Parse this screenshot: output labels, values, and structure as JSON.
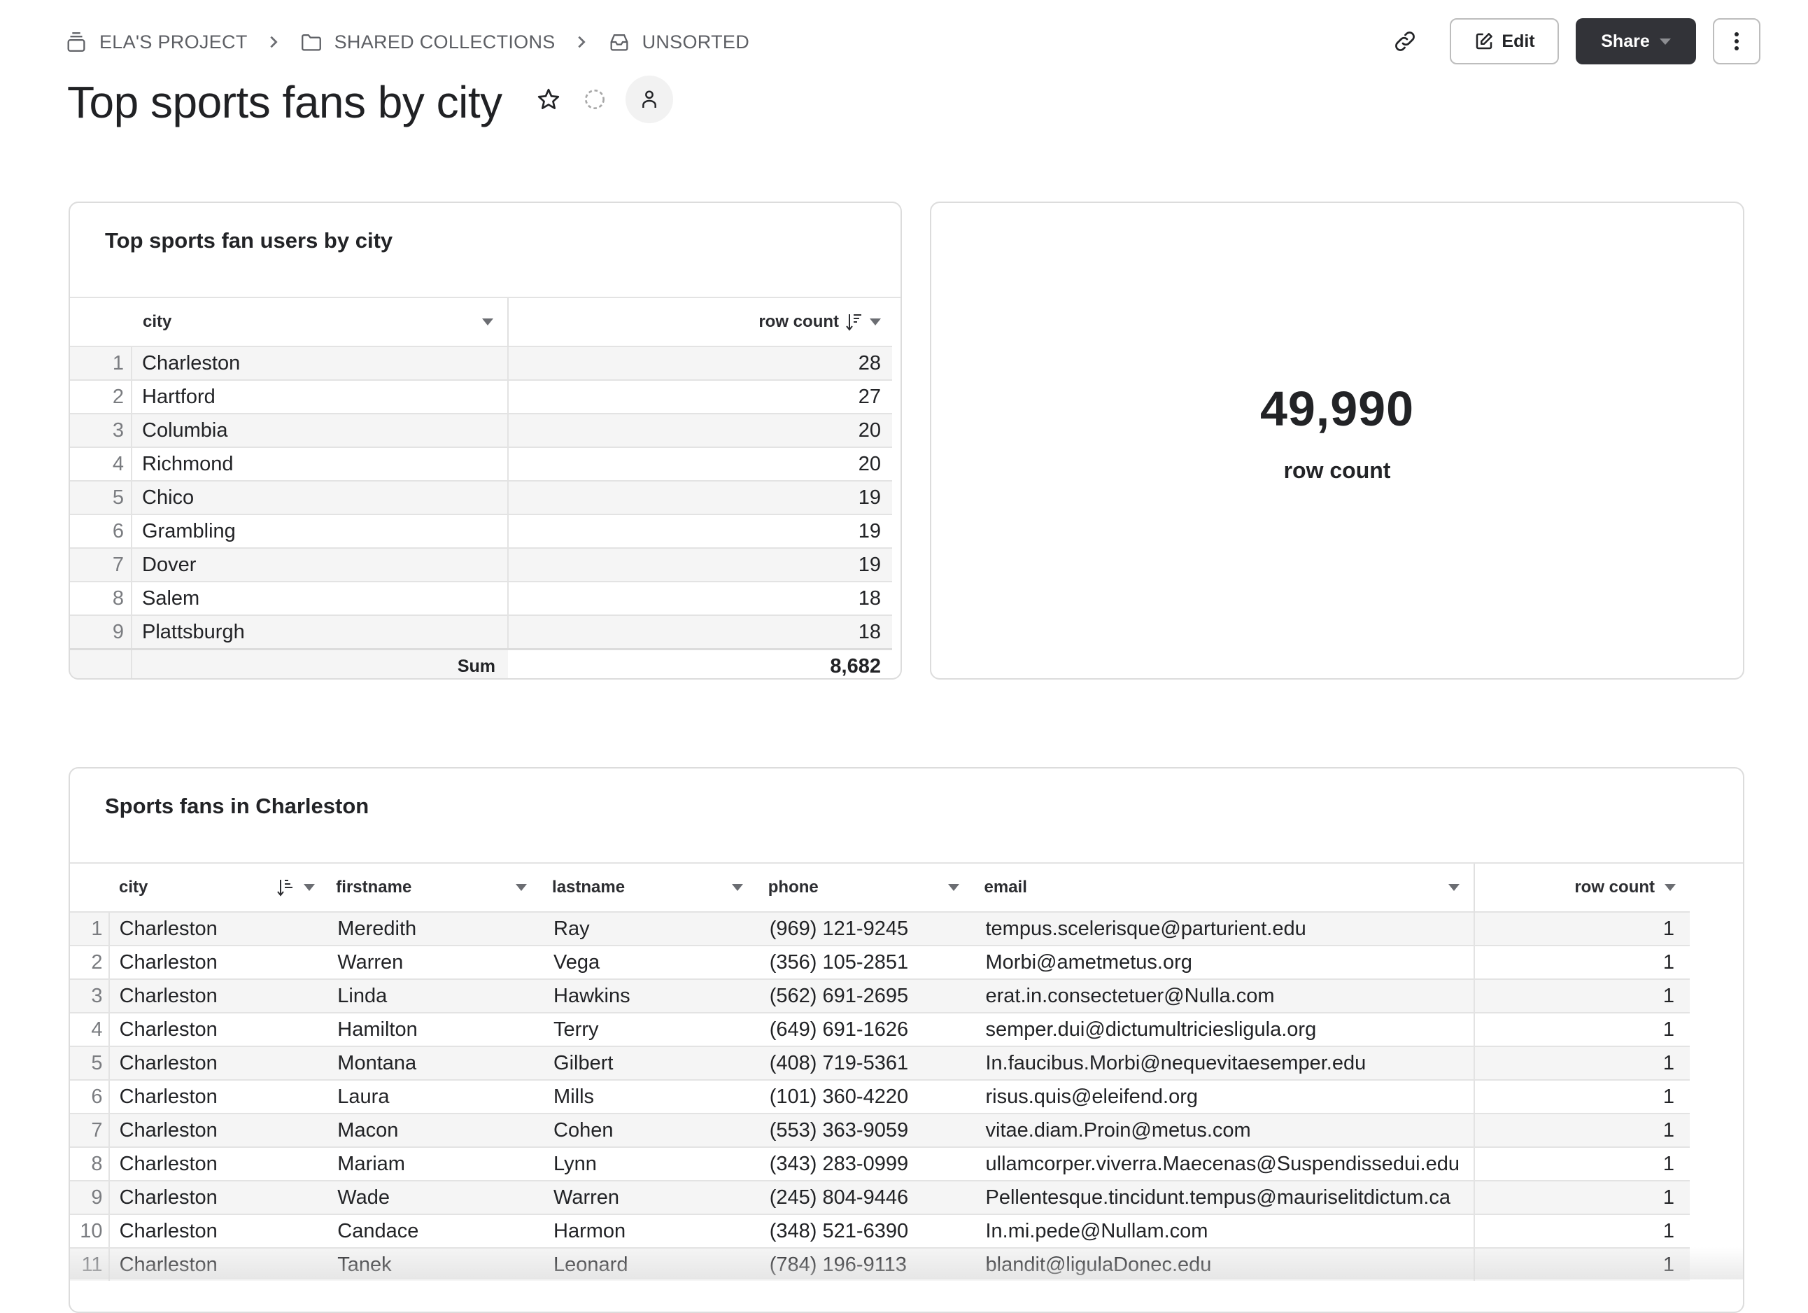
{
  "breadcrumb": [
    {
      "label": "ELA'S PROJECT",
      "icon": "project-icon"
    },
    {
      "label": "SHARED COLLECTIONS",
      "icon": "folder-icon"
    },
    {
      "label": "UNSORTED",
      "icon": "inbox-icon"
    }
  ],
  "page": {
    "title": "Top sports fans by city"
  },
  "toolbar": {
    "edit_label": "Edit",
    "share_label": "Share"
  },
  "colors": {
    "share_bg": "#323338",
    "text": "#222326",
    "stripe": "#f5f5f5",
    "border": "#dcdcdc"
  },
  "city_table": {
    "title": "Top sports fan users by city",
    "columns": [
      "city",
      "row count"
    ],
    "rows": [
      {
        "n": "1",
        "city": "Charleston",
        "count": "28"
      },
      {
        "n": "2",
        "city": "Hartford",
        "count": "27"
      },
      {
        "n": "3",
        "city": "Columbia",
        "count": "20"
      },
      {
        "n": "4",
        "city": "Richmond",
        "count": "20"
      },
      {
        "n": "5",
        "city": "Chico",
        "count": "19"
      },
      {
        "n": "6",
        "city": "Grambling",
        "count": "19"
      },
      {
        "n": "7",
        "city": "Dover",
        "count": "19"
      },
      {
        "n": "8",
        "city": "Salem",
        "count": "18"
      },
      {
        "n": "9",
        "city": "Plattsburgh",
        "count": "18"
      }
    ],
    "footer": {
      "label": "Sum",
      "value": "8,682"
    }
  },
  "metric": {
    "value": "49,990",
    "label": "row count"
  },
  "fans_table": {
    "title": "Sports fans in Charleston",
    "columns": [
      "city",
      "firstname",
      "lastname",
      "phone",
      "email",
      "row count"
    ],
    "rows": [
      {
        "n": "1",
        "city": "Charleston",
        "firstname": "Meredith",
        "lastname": "Ray",
        "phone": "(969) 121-9245",
        "email": "tempus.scelerisque@parturient.edu",
        "count": "1"
      },
      {
        "n": "2",
        "city": "Charleston",
        "firstname": "Warren",
        "lastname": "Vega",
        "phone": "(356) 105-2851",
        "email": "Morbi@ametmetus.org",
        "count": "1"
      },
      {
        "n": "3",
        "city": "Charleston",
        "firstname": "Linda",
        "lastname": "Hawkins",
        "phone": "(562) 691-2695",
        "email": "erat.in.consectetuer@Nulla.com",
        "count": "1"
      },
      {
        "n": "4",
        "city": "Charleston",
        "firstname": "Hamilton",
        "lastname": "Terry",
        "phone": "(649) 691-1626",
        "email": "semper.dui@dictumultriciesligula.org",
        "count": "1"
      },
      {
        "n": "5",
        "city": "Charleston",
        "firstname": "Montana",
        "lastname": "Gilbert",
        "phone": "(408) 719-5361",
        "email": "In.faucibus.Morbi@nequevitaesemper.edu",
        "count": "1"
      },
      {
        "n": "6",
        "city": "Charleston",
        "firstname": "Laura",
        "lastname": "Mills",
        "phone": "(101) 360-4220",
        "email": "risus.quis@eleifend.org",
        "count": "1"
      },
      {
        "n": "7",
        "city": "Charleston",
        "firstname": "Macon",
        "lastname": "Cohen",
        "phone": "(553) 363-9059",
        "email": "vitae.diam.Proin@metus.com",
        "count": "1"
      },
      {
        "n": "8",
        "city": "Charleston",
        "firstname": "Mariam",
        "lastname": "Lynn",
        "phone": "(343) 283-0999",
        "email": "ullamcorper.viverra.Maecenas@Suspendissedui.edu",
        "count": "1"
      },
      {
        "n": "9",
        "city": "Charleston",
        "firstname": "Wade",
        "lastname": "Warren",
        "phone": "(245) 804-9446",
        "email": "Pellentesque.tincidunt.tempus@mauriselitdictum.ca",
        "count": "1"
      },
      {
        "n": "10",
        "city": "Charleston",
        "firstname": "Candace",
        "lastname": "Harmon",
        "phone": "(348) 521-6390",
        "email": "In.mi.pede@Nullam.com",
        "count": "1"
      },
      {
        "n": "11",
        "city": "Charleston",
        "firstname": "Tanek",
        "lastname": "Leonard",
        "phone": "(784) 196-9113",
        "email": "blandit@ligulaDonec.edu",
        "count": "1"
      }
    ]
  }
}
